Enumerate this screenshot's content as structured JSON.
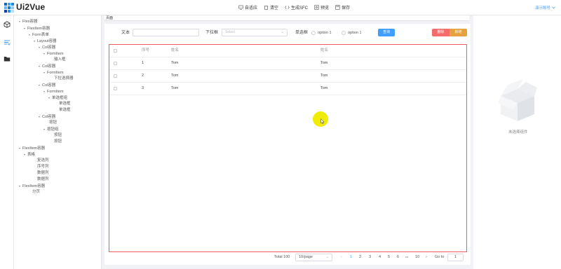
{
  "app": {
    "title": "Ui2Vue",
    "logo_colors": [
      "#1565c0",
      "#42a5f5",
      "#1e88e5",
      "#64b5f6",
      "#1976d2",
      "#90caf9",
      "#0d47a1",
      "#2196f3",
      "#bbdefb"
    ]
  },
  "toolbar": {
    "items": [
      {
        "label": "自适应",
        "icon": "monitor-icon"
      },
      {
        "label": "清空",
        "icon": "trash-icon"
      },
      {
        "label": "生成SFC",
        "icon": "code-icon"
      },
      {
        "label": "预览",
        "icon": "eye-icon"
      },
      {
        "label": "保存",
        "icon": "save-icon"
      }
    ]
  },
  "account": {
    "label": "演示账号",
    "icon": "chevron-down-icon"
  },
  "rail": {
    "items": [
      {
        "icon": "cube-icon",
        "active": false
      },
      {
        "icon": "list-icon",
        "active": true
      },
      {
        "icon": "folder-icon",
        "active": false
      }
    ]
  },
  "tree": {
    "nodes": [
      {
        "label": "Flex容器",
        "caret": true
      },
      {
        "label": "FlexItem容器",
        "caret": true
      },
      {
        "label": "Form表单",
        "caret": true
      },
      {
        "label": "Layout容器",
        "caret": true
      },
      {
        "label": "Col容器",
        "caret": true
      },
      {
        "label": "FormItem",
        "caret": true
      },
      {
        "label": "输入框",
        "caret": false
      },
      {
        "label": "Col容器",
        "caret": true
      },
      {
        "label": "FormItem",
        "caret": true
      },
      {
        "label": "下拉选择器",
        "caret": false
      },
      {
        "label": "Col容器",
        "caret": true
      },
      {
        "label": "FormItem",
        "caret": true
      },
      {
        "label": "单选框组",
        "caret": true
      },
      {
        "label": "单选框",
        "caret": false
      },
      {
        "label": "单选框",
        "caret": false
      },
      {
        "label": "Col容器",
        "caret": true
      },
      {
        "label": "按钮",
        "caret": false
      },
      {
        "label": "按钮组",
        "caret": true
      },
      {
        "label": "按钮",
        "caret": false
      },
      {
        "label": "按钮",
        "caret": false
      },
      {
        "label": "FlexItem容器",
        "caret": true
      },
      {
        "label": "表格",
        "caret": true
      },
      {
        "label": "复选列",
        "caret": false
      },
      {
        "label": "序号列",
        "caret": false
      },
      {
        "label": "数据列",
        "caret": false
      },
      {
        "label": "数据列",
        "caret": false
      },
      {
        "label": "FlexItem容器",
        "caret": true
      },
      {
        "label": "分页",
        "caret": false
      }
    ]
  },
  "canvas": {
    "tab_label": "页面"
  },
  "form": {
    "text_label": "文本",
    "text_value": "",
    "select_label": "下拉框",
    "select_placeholder": "Select",
    "radio_label": "单选框",
    "radio_options": [
      "option 1",
      "option 1"
    ],
    "query_button": "查询",
    "delete_button": "删除",
    "add_button": "新增",
    "colors": {
      "query": "#409eff",
      "delete": "#f56c6c",
      "add": "#e6a23c"
    }
  },
  "table": {
    "columns": [
      "",
      "序号",
      "姓名",
      "姓名"
    ],
    "rows": [
      {
        "index": "1",
        "name": "Tom",
        "name2": "Tom"
      },
      {
        "index": "2",
        "name": "Tom",
        "name2": "Tom"
      },
      {
        "index": "3",
        "name": "Tom",
        "name2": "Tom"
      }
    ]
  },
  "pagination": {
    "total": "Total 100",
    "page_size": "10/page",
    "prev": "‹",
    "pages": [
      "1",
      "2",
      "3",
      "4",
      "5",
      "6"
    ],
    "ellipsis": "•••",
    "last": "10",
    "next": "›",
    "goto_label": "Go to",
    "goto_value": "1"
  },
  "properties": {
    "empty_text": "未选择组件"
  }
}
